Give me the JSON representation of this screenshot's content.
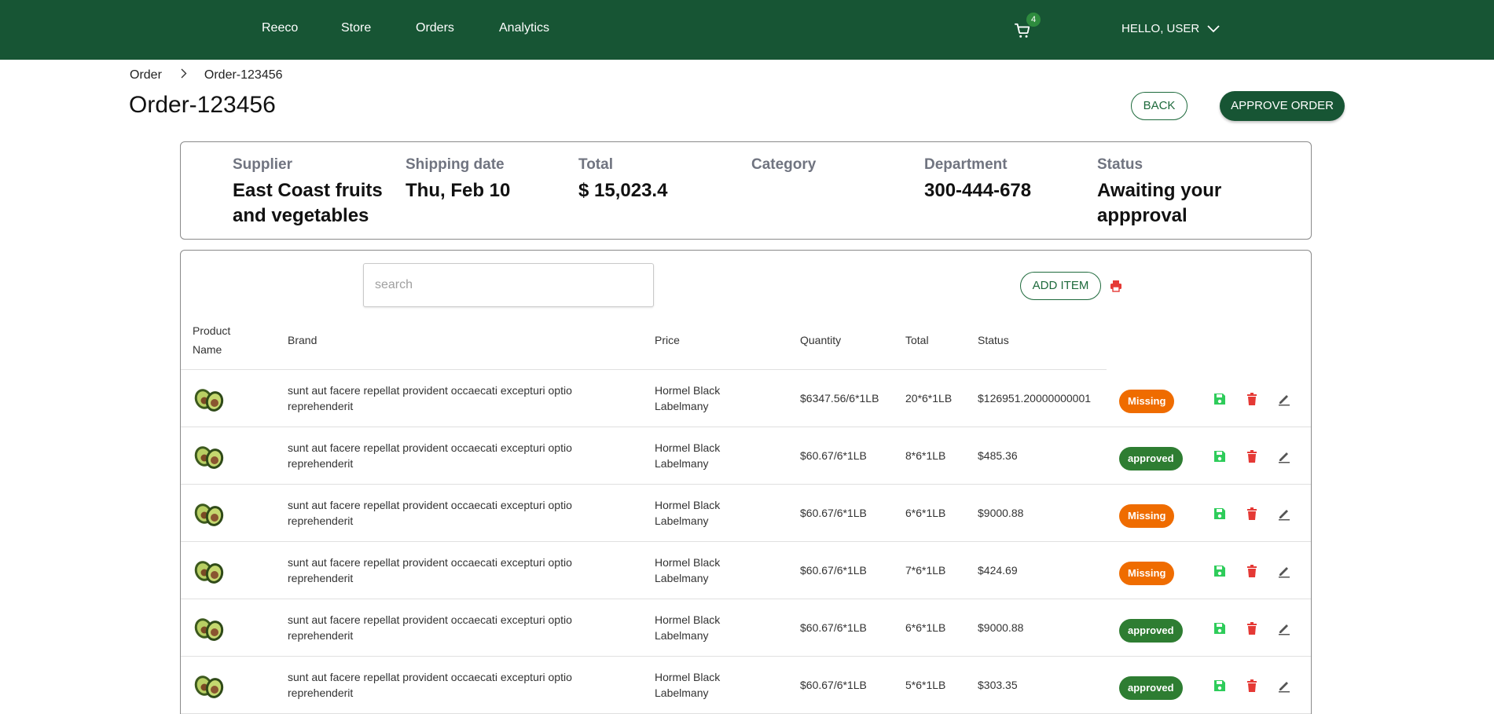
{
  "nav": {
    "links": [
      "Reeco",
      "Store",
      "Orders",
      "Analytics"
    ],
    "cart_count": "4",
    "user_label": "HELLO, USER",
    "bg_color": "#175534"
  },
  "breadcrumb": {
    "parent": "Order",
    "current": "Order-123456"
  },
  "page": {
    "title": "Order-123456",
    "back_label": "BACK",
    "approve_label": "APPROVE ORDER"
  },
  "summary": {
    "supplier_label": "Supplier",
    "supplier_value": "East Coast fruits and vegetables",
    "shipping_label": "Shipping date",
    "shipping_value": "Thu, Feb 10",
    "total_label": "Total",
    "total_value": "$ 15,023.4",
    "category_label": "Category",
    "category_value": "",
    "department_label": "Department",
    "department_value": "300-444-678",
    "status_label": "Status",
    "status_value": "Awaiting your appproval"
  },
  "table": {
    "search_placeholder": "search",
    "add_label": "ADD ITEM",
    "headers": {
      "product": "Product Name",
      "brand": "Brand",
      "price": "Price",
      "quantity": "Quantity",
      "total": "Total",
      "status": "Status"
    },
    "rows": [
      {
        "product": "sunt aut facere repellat provident occaecati excepturi optio reprehenderit",
        "brand": "Hormel Black Labelmany",
        "price": "$6347.56/6*1LB",
        "quantity": "20*6*1LB",
        "total": "$126951.20000000001",
        "status": "Missing"
      },
      {
        "product": "sunt aut facere repellat provident occaecati excepturi optio reprehenderit",
        "brand": "Hormel Black Labelmany",
        "price": "$60.67/6*1LB",
        "quantity": "8*6*1LB",
        "total": "$485.36",
        "status": "approved"
      },
      {
        "product": "sunt aut facere repellat provident occaecati excepturi optio reprehenderit",
        "brand": "Hormel Black Labelmany",
        "price": "$60.67/6*1LB",
        "quantity": "6*6*1LB",
        "total": "$9000.88",
        "status": "Missing"
      },
      {
        "product": "sunt aut facere repellat provident occaecati excepturi optio reprehenderit",
        "brand": "Hormel Black Labelmany",
        "price": "$60.67/6*1LB",
        "quantity": "7*6*1LB",
        "total": "$424.69",
        "status": "Missing"
      },
      {
        "product": "sunt aut facere repellat provident occaecati excepturi optio reprehenderit",
        "brand": "Hormel Black Labelmany",
        "price": "$60.67/6*1LB",
        "quantity": "6*6*1LB",
        "total": "$9000.88",
        "status": "approved"
      },
      {
        "product": "sunt aut facere repellat provident occaecati excepturi optio reprehenderit",
        "brand": "Hormel Black Labelmany",
        "price": "$60.67/6*1LB",
        "quantity": "5*6*1LB",
        "total": "$303.35",
        "status": "approved"
      }
    ],
    "status_colors": {
      "Missing": "#ef6c00",
      "approved": "#2e7d32"
    },
    "icons": {
      "save": "save-icon",
      "delete": "trash-icon",
      "edit": "pencil-icon",
      "print": "printer-icon"
    }
  }
}
